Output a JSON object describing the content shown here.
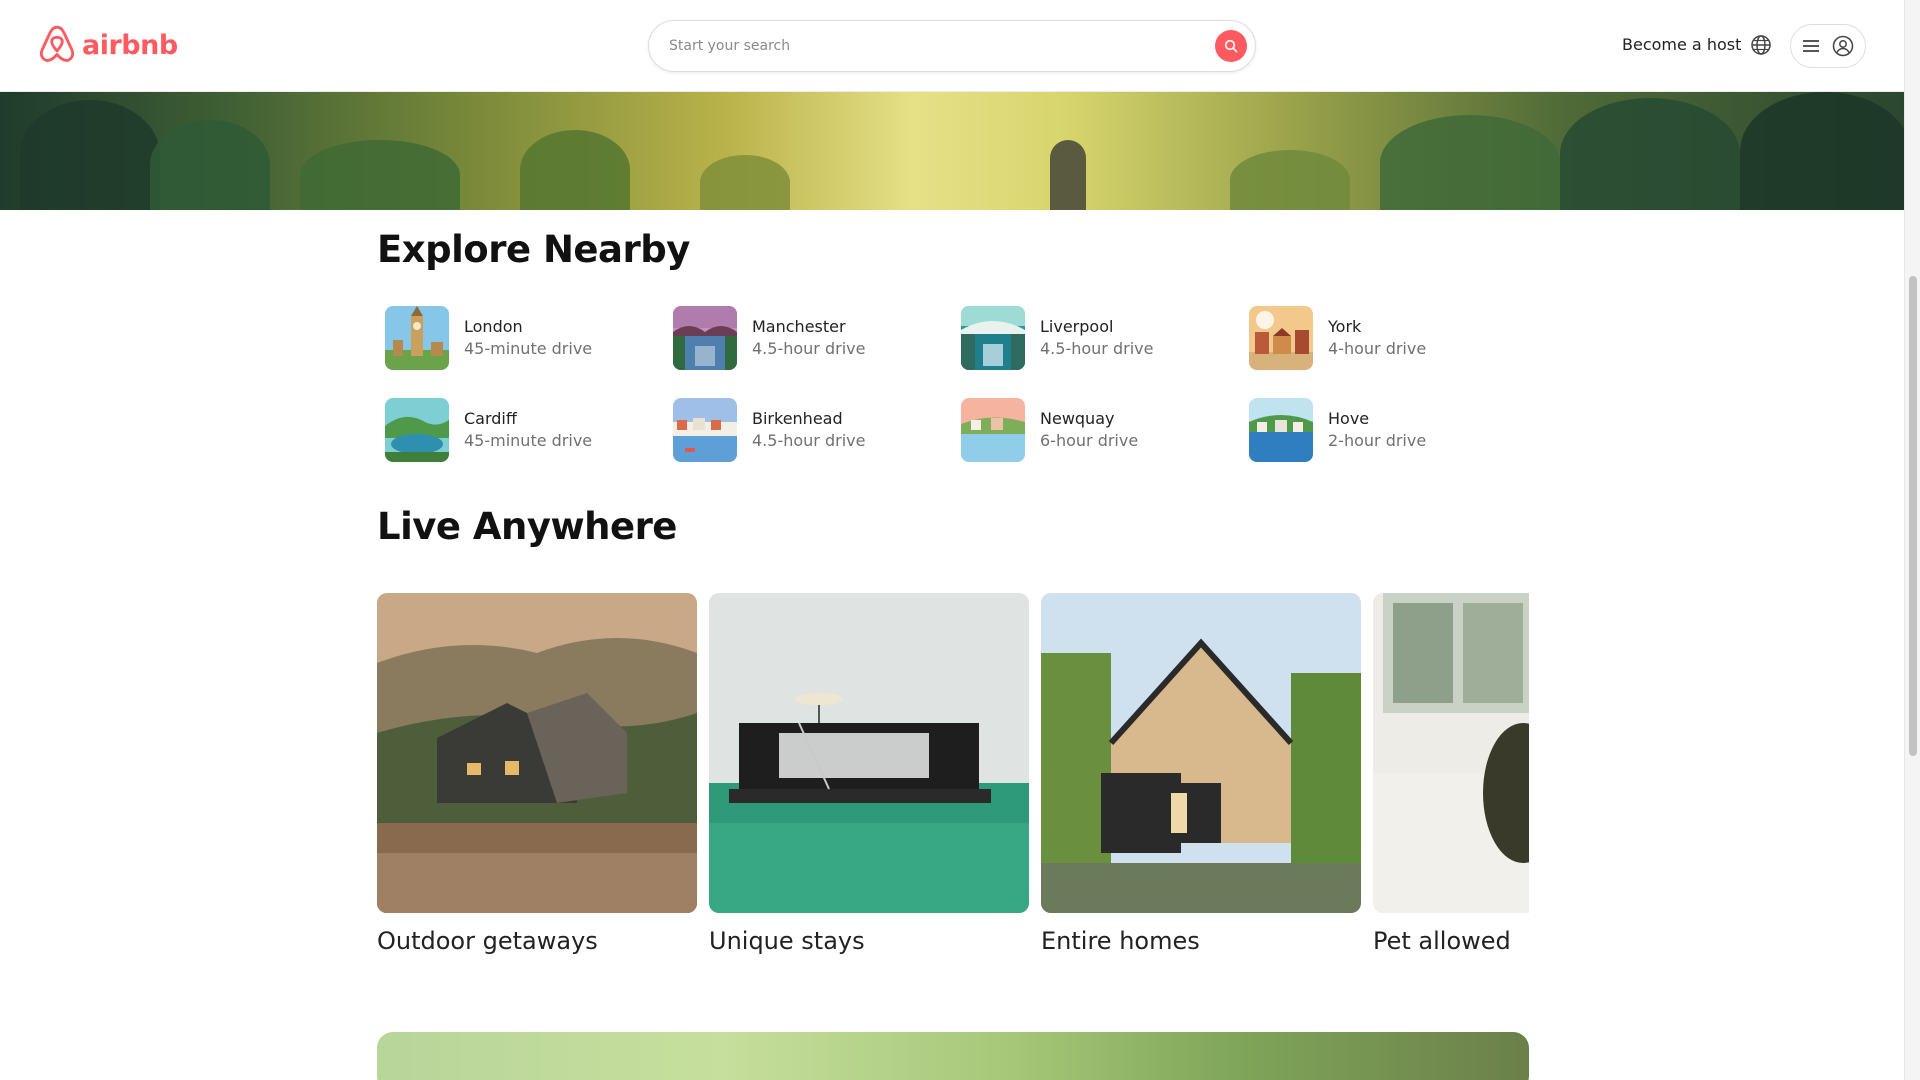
{
  "header": {
    "logo_text": "airbnb",
    "search_placeholder": "Start your search",
    "host_link": "Become a host",
    "brand_color": "#ff5a5f"
  },
  "explore": {
    "title": "Explore Nearby",
    "items": [
      {
        "city": "London",
        "drive": "45-minute drive"
      },
      {
        "city": "Manchester",
        "drive": "4.5-hour drive"
      },
      {
        "city": "Liverpool",
        "drive": "4.5-hour drive"
      },
      {
        "city": "York",
        "drive": "4-hour drive"
      },
      {
        "city": "Cardiff",
        "drive": "45-minute drive"
      },
      {
        "city": "Birkenhead",
        "drive": "4.5-hour drive"
      },
      {
        "city": "Newquay",
        "drive": "6-hour drive"
      },
      {
        "city": "Hove",
        "drive": "2-hour drive"
      }
    ]
  },
  "live": {
    "title": "Live Anywhere",
    "cards": [
      {
        "label": "Outdoor getaways"
      },
      {
        "label": "Unique stays"
      },
      {
        "label": "Entire homes"
      },
      {
        "label": "Pet allowed"
      }
    ]
  }
}
